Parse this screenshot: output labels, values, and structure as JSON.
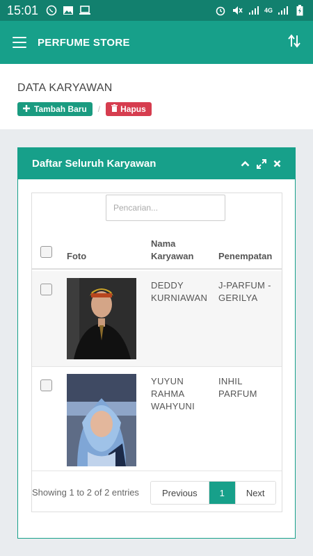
{
  "status_bar": {
    "time": "15:01",
    "left_icons": [
      "whatsapp-icon",
      "image-icon",
      "laptop-icon"
    ],
    "right_icons": [
      "alarm-icon",
      "mute-icon",
      "signal-icon",
      "4g-signal-icon",
      "battery-charging-icon"
    ],
    "network_label": "4G"
  },
  "app_bar": {
    "title": "PERFUME STORE"
  },
  "page": {
    "title": "DATA KARYAWAN",
    "add_label": "Tambah Baru",
    "separator": "/",
    "delete_label": "Hapus"
  },
  "card": {
    "title": "Daftar Seluruh Karyawan"
  },
  "table": {
    "search_placeholder": "Pencarian...",
    "headers": {
      "photo": "Foto",
      "name_line1": "Nama",
      "name_line2": "Karyawan",
      "placement": "Penempatan"
    },
    "rows": [
      {
        "name_lines": [
          "DEDDY",
          "KURNIAWAN"
        ],
        "placement_lines": [
          "J-PARFUM -",
          "GERILYA"
        ]
      },
      {
        "name_lines": [
          "YUYUN",
          "RAHMA",
          "WAHYUNI"
        ],
        "placement_lines": [
          "INHIL",
          "PARFUM"
        ]
      }
    ],
    "info": "Showing 1 to 2 of 2 entries",
    "pagination": {
      "previous": "Previous",
      "current": "1",
      "next": "Next"
    }
  },
  "colors": {
    "primary": "#17a08a",
    "status_bar": "#12806e",
    "danger": "#d63d4f",
    "background": "#e9ecef"
  }
}
